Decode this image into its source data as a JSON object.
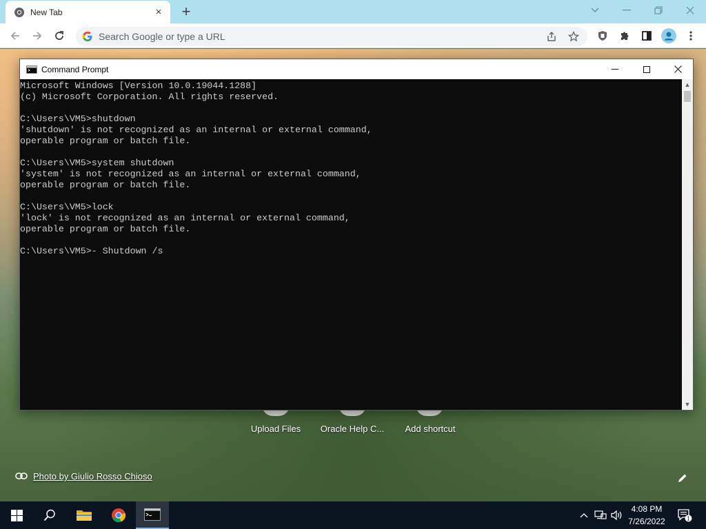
{
  "browser": {
    "tab": {
      "title": "New Tab",
      "favicon": "chrome-icon",
      "close": "×"
    },
    "new_tab_symbol": "+",
    "omnibox": {
      "placeholder": "Search Google or type a URL"
    },
    "window_controls": [
      "chevron-down-icon",
      "minimize-icon",
      "restore-icon",
      "close-icon"
    ],
    "toolbar_icons": [
      "back-icon",
      "forward-icon",
      "reload-icon",
      "share-icon",
      "star-icon",
      "shield-extension-icon",
      "puzzle-icon",
      "side-panel-icon",
      "profile-icon",
      "more-icon"
    ]
  },
  "new_tab_page": {
    "shortcuts": [
      {
        "label": "Upload Files"
      },
      {
        "label": "Oracle Help C..."
      },
      {
        "label": "Add shortcut"
      }
    ],
    "photo_credit": "Photo by Giulio Rosso Chioso"
  },
  "cmd": {
    "title": "Command Prompt",
    "lines": [
      "Microsoft Windows [Version 10.0.19044.1288]",
      "(c) Microsoft Corporation. All rights reserved.",
      "",
      "C:\\Users\\VM5>shutdown",
      "'shutdown' is not recognized as an internal or external command,",
      "operable program or batch file.",
      "",
      "C:\\Users\\VM5>system shutdown",
      "'system' is not recognized as an internal or external command,",
      "operable program or batch file.",
      "",
      "C:\\Users\\VM5>lock",
      "'lock' is not recognized as an internal or external command,",
      "operable program or batch file.",
      "",
      "C:\\Users\\VM5>- Shutdown /s"
    ]
  },
  "taskbar": {
    "items": [
      "windows-start-icon",
      "search-icon",
      "file-explorer-icon",
      "chrome-icon",
      "command-prompt-icon"
    ],
    "time": "4:08 PM",
    "date": "7/26/2022",
    "notification_count": "1"
  },
  "colors": {
    "tabstrip": "#aee0f0",
    "console_bg": "#0c0c0c",
    "console_text": "#cccccc",
    "taskbar": "#0a1420"
  }
}
